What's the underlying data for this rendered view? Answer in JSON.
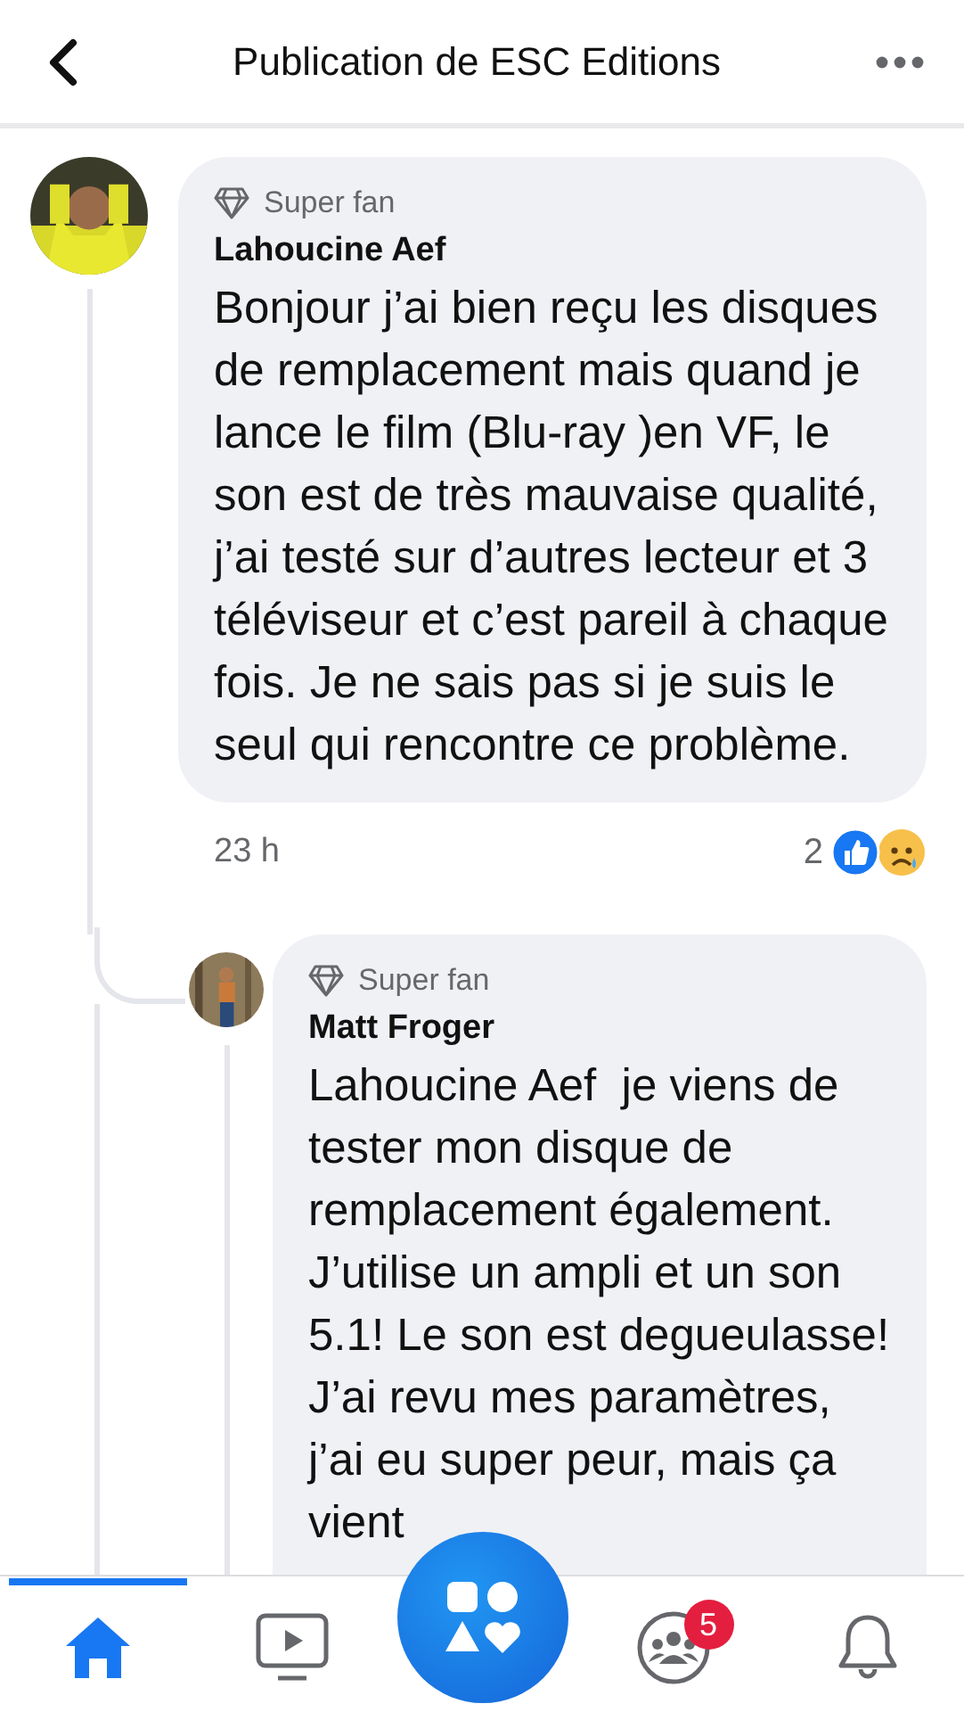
{
  "header": {
    "title": "Publication de ESC Editions"
  },
  "comment": {
    "badge": "Super fan",
    "author": "Lahoucine Aef",
    "text": "Bonjour j’ai bien reçu les disques de remplacement mais quand je lance le film (Blu-ray )en VF, le son est de très mauvaise qualité, j’ai testé sur d’autres lecteur et 3 téléviseur et c’est pareil à chaque fois. Je ne sais pas si je suis le seul qui rencontre ce problème.",
    "time": "23 h",
    "reaction_count": "2",
    "reactions": [
      {
        "kind": "like"
      },
      {
        "kind": "sad"
      }
    ]
  },
  "reply": {
    "badge": "Super fan",
    "author": "Matt Froger",
    "text": "Lahoucine Aef  je viens de tester mon disque de remplacement également. J’utilise un ampli et un son 5.1! Le son est degueulasse! J’ai revu mes paramètres, j’ai eu super peur, mais ça vient"
  },
  "nav": [
    {
      "kind": "home",
      "selected": true
    },
    {
      "kind": "video",
      "selected": false
    },
    {
      "kind": "create",
      "selected": false
    },
    {
      "kind": "groups",
      "selected": false,
      "badge": "5"
    },
    {
      "kind": "bell",
      "selected": false
    }
  ]
}
